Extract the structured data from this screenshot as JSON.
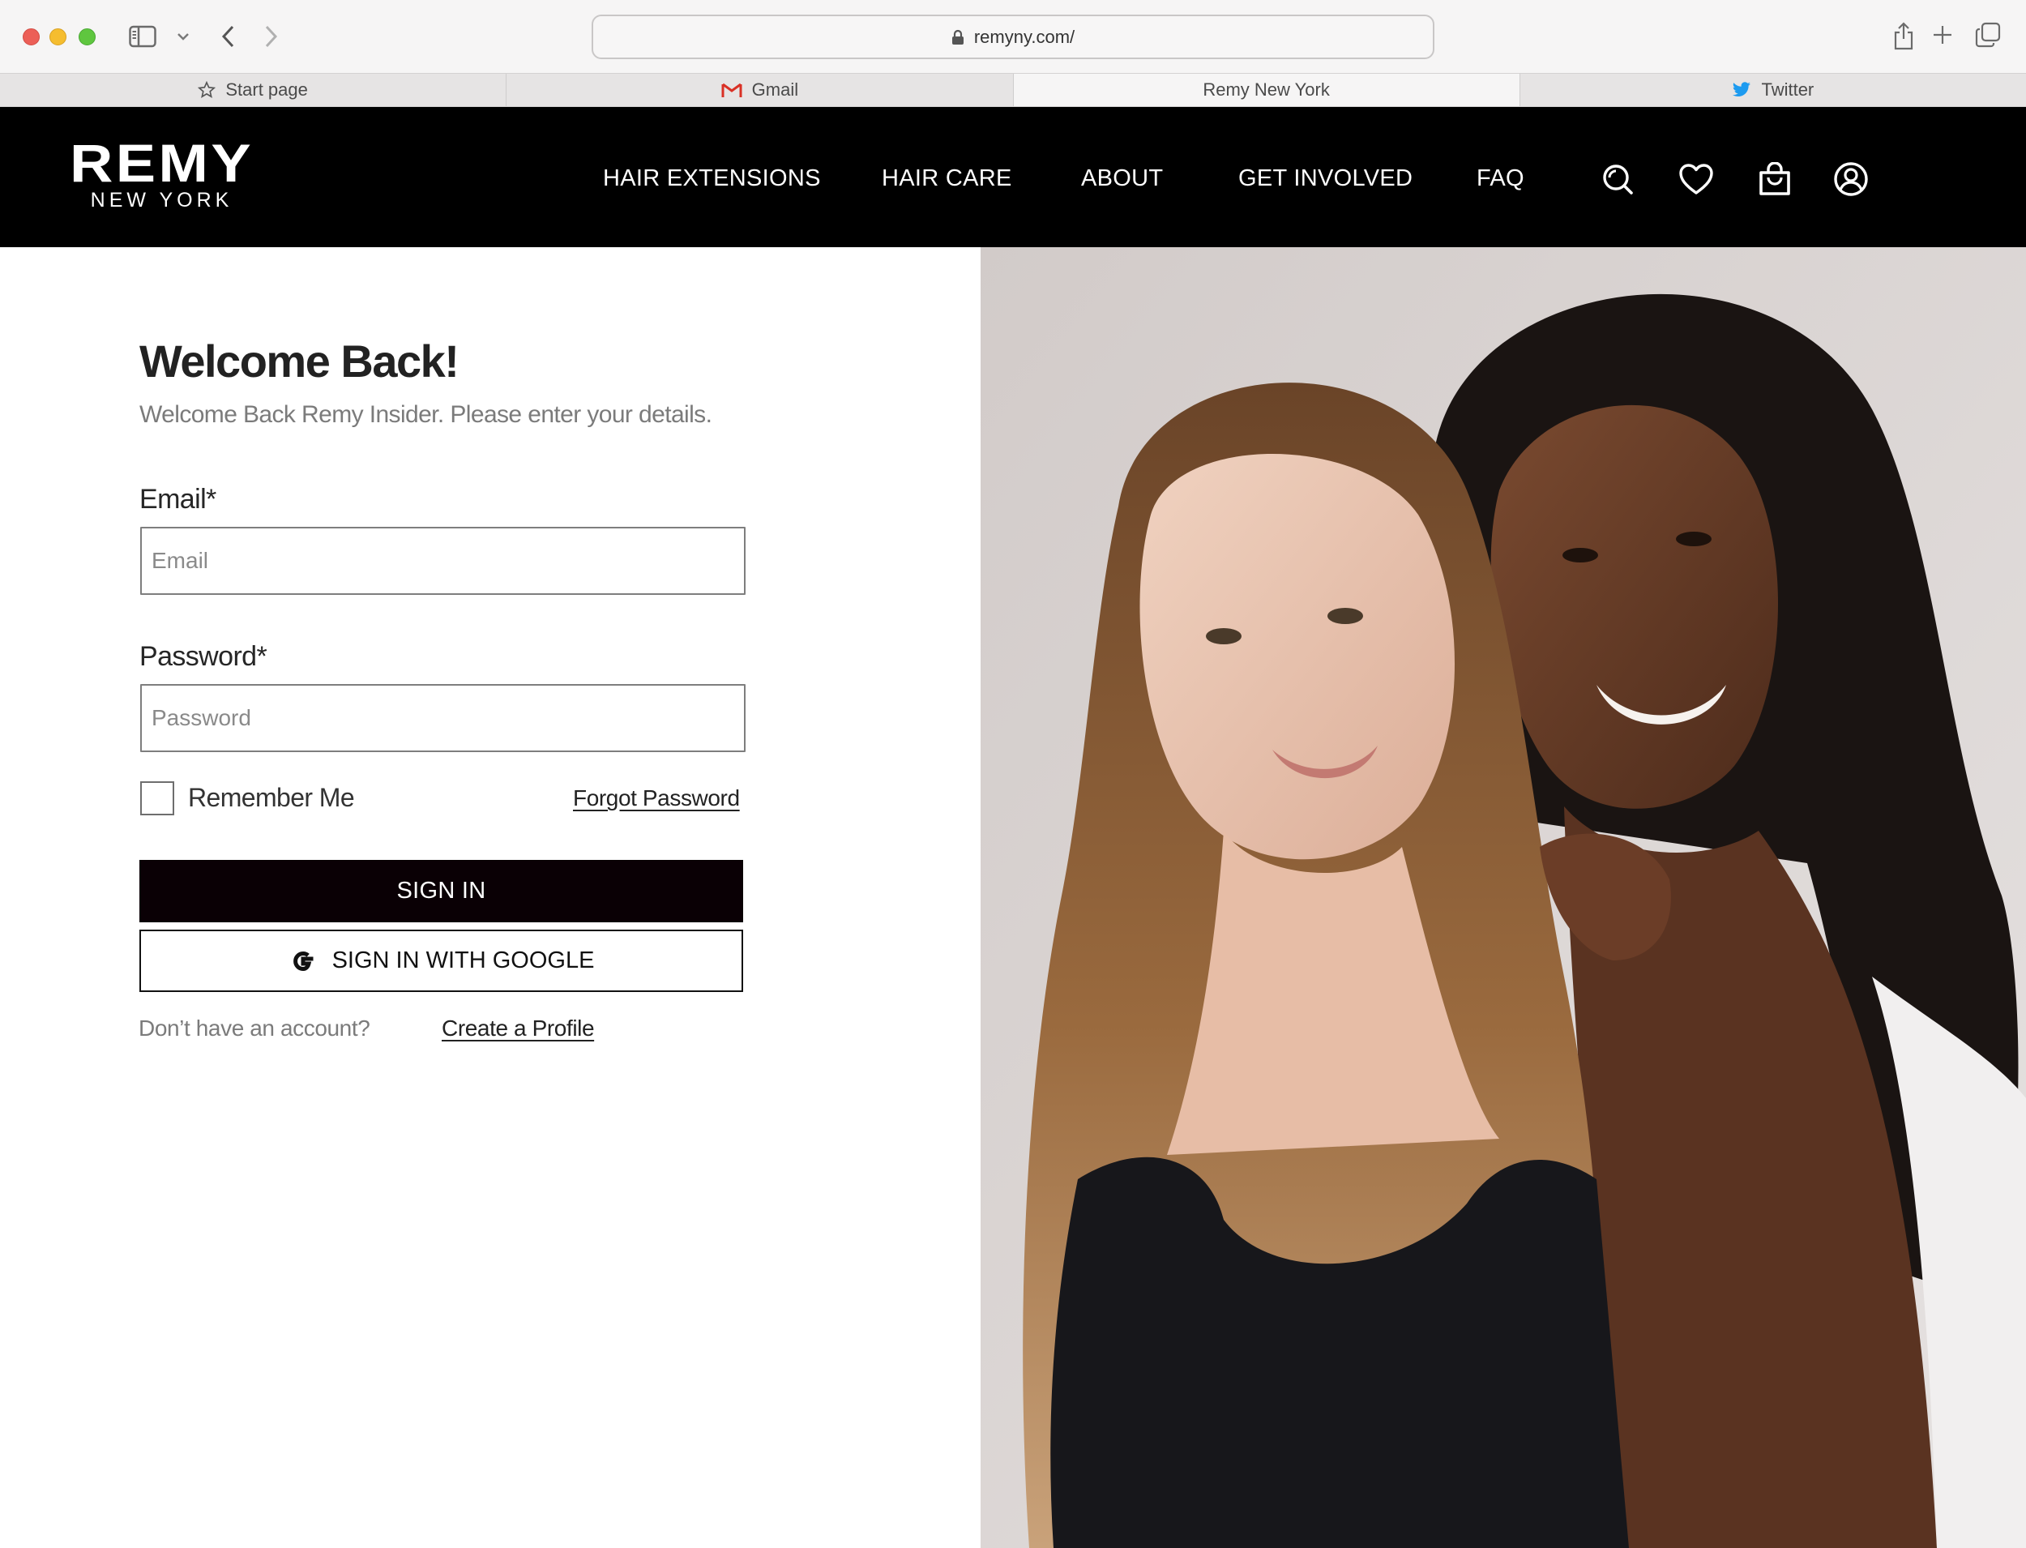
{
  "browser": {
    "url": "remyny.com/",
    "tabs": [
      {
        "label": "Start page",
        "icon": "star-icon"
      },
      {
        "label": "Gmail",
        "icon": "gmail-icon"
      },
      {
        "label": "Remy New York",
        "active": true
      },
      {
        "label": "Twitter",
        "icon": "twitter-icon"
      }
    ]
  },
  "header": {
    "logo_main": "REMY",
    "logo_sub": "NEW YORK",
    "nav": [
      "HAIR EXTENSIONS",
      "HAIR CARE",
      "ABOUT",
      "GET INVOLVED",
      "FAQ"
    ],
    "icons": [
      "search-icon",
      "heart-icon",
      "bag-icon",
      "account-icon"
    ]
  },
  "login": {
    "title": "Welcome Back!",
    "subtitle": "Welcome Back Remy Insider. Please enter your details.",
    "email_label": "Email*",
    "email_placeholder": "Email",
    "email_value": "",
    "password_label": "Password*",
    "password_placeholder": "Password",
    "password_value": "",
    "remember_label": "Remember Me",
    "remember_checked": false,
    "forgot_label": "Forgot Password",
    "signin_label": "SIGN IN",
    "google_label": "SIGN IN WITH GOOGLE",
    "no_account_text": "Don’t have an account?",
    "create_label": "Create a Profile"
  },
  "colors": {
    "header_bg": "#000000",
    "primary_button": "#0a0005",
    "text_dark": "#222222",
    "text_muted": "#7b7b7b"
  }
}
